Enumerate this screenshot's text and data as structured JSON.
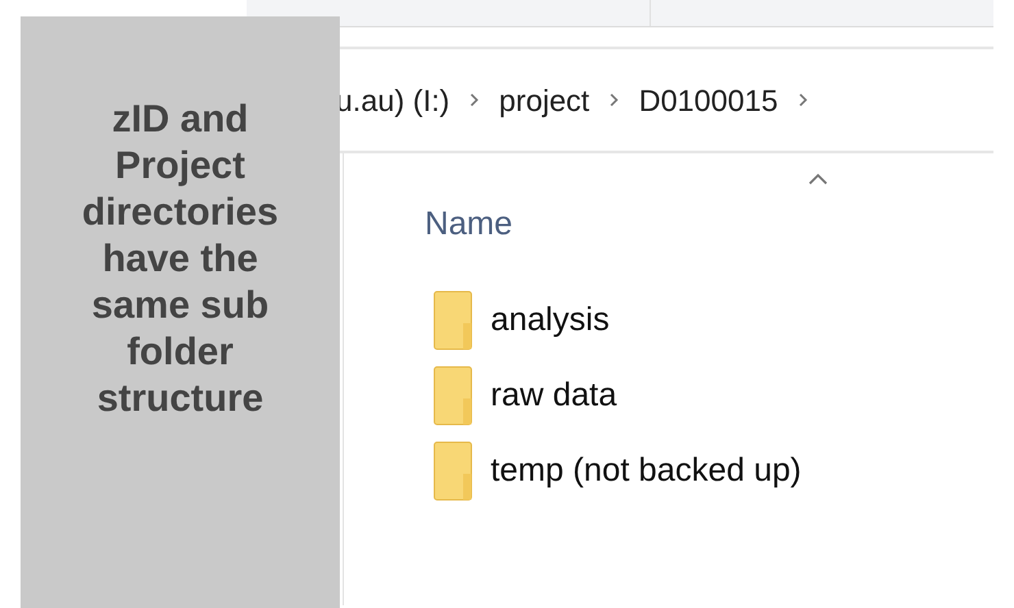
{
  "callout": {
    "text": "zID and Project directories have the same sub folder structure"
  },
  "breadcrumb": [
    "u.au) (I:)",
    "project",
    "D0100015"
  ],
  "file_list": {
    "column": "Name",
    "sorted": true,
    "items": [
      {
        "name": "analysis",
        "kind": "folder"
      },
      {
        "name": "raw data",
        "kind": "folder"
      },
      {
        "name": "temp (not backed up)",
        "kind": "folder"
      }
    ]
  }
}
